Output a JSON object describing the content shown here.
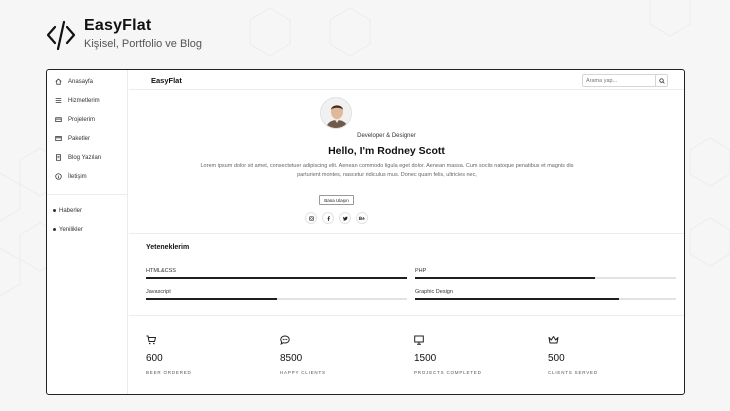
{
  "brand": {
    "title": "EasyFlat",
    "subtitle": "Kişisel, Portfolio ve Blog"
  },
  "sidebar": {
    "items": [
      {
        "label": "Anasayfa",
        "icon": "home-icon"
      },
      {
        "label": "Hizmetlerim",
        "icon": "list-icon"
      },
      {
        "label": "Projelerim",
        "icon": "folder-icon"
      },
      {
        "label": "Paketler",
        "icon": "card-icon"
      },
      {
        "label": "Blog Yazıları",
        "icon": "document-icon"
      },
      {
        "label": "İletişim",
        "icon": "info-icon"
      }
    ],
    "news": [
      {
        "label": "Haberler"
      },
      {
        "label": "Yenilikler"
      }
    ]
  },
  "topbar": {
    "title": "EasyFlat",
    "search_placeholder": "Arama yap..."
  },
  "hero": {
    "role": "Developer & Designer",
    "headline": "Hello, I'm Rodney Scott",
    "bio": "Lorem ipsum dolor sit amet, consectetuer adipiscing elit. Aenean commodo ligula eget dolor. Aenean massa. Cum sociis natoque penatibus et magnis dis parturient montes, nascetur ridiculus mus. Donec quam felis, ultricies nec,",
    "contact_label": "Bana Ulaşın",
    "socials": [
      "instagram-icon",
      "facebook-icon",
      "twitter-icon",
      "behance-icon"
    ]
  },
  "skills": {
    "title": "Yeteneklerim",
    "items": [
      {
        "name": "HTML&CSS",
        "level": 1.0
      },
      {
        "name": "PHP",
        "level": 0.69
      },
      {
        "name": "Javascript",
        "level": 0.5
      },
      {
        "name": "Graphic Design",
        "level": 0.78
      }
    ]
  },
  "stats": [
    {
      "icon": "cart-icon",
      "value": "600",
      "label": "BEER ORDERED"
    },
    {
      "icon": "chat-icon",
      "value": "8500",
      "label": "HAPPY CLIENTS"
    },
    {
      "icon": "monitor-icon",
      "value": "1500",
      "label": "PROJECTS COMPLETED"
    },
    {
      "icon": "crown-icon",
      "value": "500",
      "label": "CLIENTS SERVED"
    }
  ]
}
